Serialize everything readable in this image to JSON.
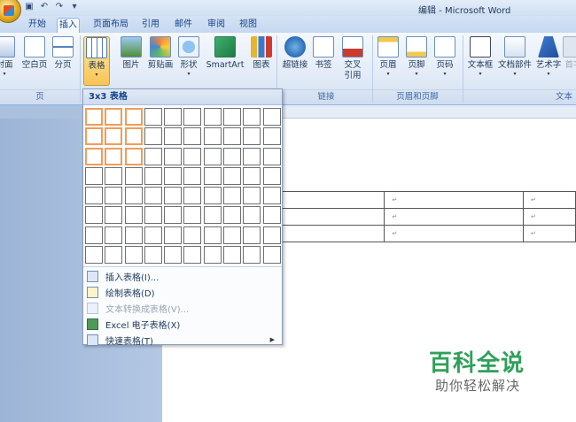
{
  "window": {
    "title": "编辑 - Microsoft Word"
  },
  "tabs": [
    {
      "label": "开始",
      "active": false
    },
    {
      "label": "插入",
      "active": true
    },
    {
      "label": "页面布局",
      "active": false
    },
    {
      "label": "引用",
      "active": false
    },
    {
      "label": "邮件",
      "active": false
    },
    {
      "label": "审阅",
      "active": false
    },
    {
      "label": "视图",
      "active": false
    }
  ],
  "ribbon": {
    "buttons": [
      {
        "label": "封面",
        "arrow": true,
        "icon": "cover-page-icon"
      },
      {
        "label": "空白页",
        "arrow": false,
        "icon": "blank-page-icon"
      },
      {
        "label": "分页",
        "arrow": false,
        "icon": "page-break-icon"
      },
      {
        "label": "表格",
        "arrow": true,
        "icon": "table-icon"
      },
      {
        "label": "图片",
        "arrow": false,
        "icon": "picture-icon"
      },
      {
        "label": "剪贴画",
        "arrow": false,
        "icon": "clip-art-icon"
      },
      {
        "label": "形状",
        "arrow": true,
        "icon": "shapes-icon"
      },
      {
        "label": "SmartArt",
        "arrow": false,
        "icon": "smartart-icon"
      },
      {
        "label": "图表",
        "arrow": false,
        "icon": "chart-icon"
      },
      {
        "label": "超链接",
        "arrow": false,
        "icon": "hyperlink-icon"
      },
      {
        "label": "书签",
        "arrow": false,
        "icon": "bookmark-icon"
      },
      {
        "label": "交叉\n引用",
        "arrow": false,
        "icon": "cross-reference-icon"
      },
      {
        "label": "页眉",
        "arrow": true,
        "icon": "header-icon"
      },
      {
        "label": "页脚",
        "arrow": true,
        "icon": "footer-icon"
      },
      {
        "label": "页码",
        "arrow": true,
        "icon": "page-number-icon"
      },
      {
        "label": "文本框",
        "arrow": true,
        "icon": "text-box-icon"
      },
      {
        "label": "文档部件",
        "arrow": true,
        "icon": "quick-parts-icon"
      },
      {
        "label": "艺术字",
        "arrow": true,
        "icon": "wordart-icon"
      },
      {
        "label": "首字",
        "arrow": false,
        "icon": "drop-cap-icon"
      }
    ],
    "groups": [
      {
        "label": "页"
      },
      {
        "label": "链接"
      },
      {
        "label": "页眉和页脚"
      },
      {
        "label": "文本"
      }
    ]
  },
  "table_dropdown": {
    "header": "3x3 表格",
    "grid_columns": 10,
    "grid_rows": 8,
    "selected_columns": 3,
    "selected_rows": 3,
    "highlight_color": "#f09d5a",
    "menu": [
      {
        "label": "插入表格(I)...",
        "icon": "insert-table-icon",
        "enabled": true,
        "submenu": false
      },
      {
        "label": "绘制表格(D)",
        "icon": "draw-table-icon",
        "enabled": true,
        "submenu": false
      },
      {
        "label": "文本转换成表格(V)...",
        "icon": "text-to-table-icon",
        "enabled": false,
        "submenu": false
      },
      {
        "label": "Excel 电子表格(X)",
        "icon": "excel-icon",
        "enabled": true,
        "submenu": false
      },
      {
        "label": "快速表格(T)",
        "icon": "quick-tables-icon",
        "enabled": true,
        "submenu": true
      }
    ]
  },
  "document": {
    "table": {
      "rows": 3,
      "cells": [
        [
          "",
          "↵",
          "↵"
        ],
        [
          "",
          "↵",
          "↵"
        ],
        [
          "",
          "↵",
          "↵"
        ]
      ]
    }
  },
  "watermark": {
    "title": "百科全说",
    "subtitle": "助你轻松解决"
  }
}
